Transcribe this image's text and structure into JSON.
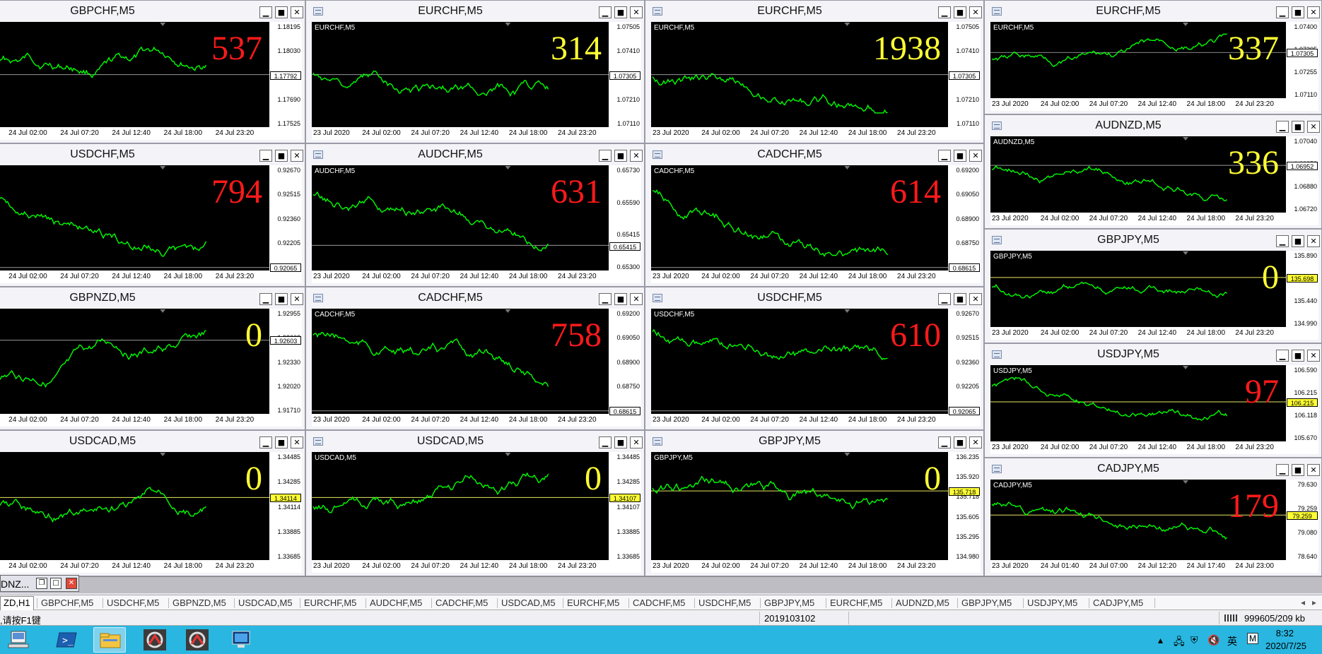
{
  "windows": [
    {
      "title": "GBPCHF,M5",
      "sym": "HF,M5",
      "icon": false,
      "bignum": "537",
      "color": "red",
      "ylabels": [
        "1.18195",
        "1.18030",
        "1.17860",
        "1.17690",
        "1.17525"
      ],
      "price": "1.17792",
      "pricePos": 0.5,
      "hl": false,
      "xlabels": [
        "20",
        "24 Jul 02:00",
        "24 Jul 07:20",
        "24 Jul 12:40",
        "24 Jul 18:00",
        "24 Jul 23:20"
      ]
    },
    {
      "title": "EURCHF,M5",
      "sym": "EURCHF,M5",
      "icon": true,
      "bignum": "314",
      "color": "yellow",
      "ylabels": [
        "1.07505",
        "1.07410",
        "1.07305",
        "1.07210",
        "1.07110"
      ],
      "price": "1.07305",
      "pricePos": 0.5,
      "hl": false,
      "xlabels": [
        "23 Jul 2020",
        "24 Jul 02:00",
        "24 Jul 07:20",
        "24 Jul 12:40",
        "24 Jul 18:00",
        "24 Jul 23:20"
      ]
    },
    {
      "title": "EURCHF,M5",
      "sym": "EURCHF,M5",
      "icon": true,
      "bignum": "1938",
      "color": "yellow",
      "ylabels": [
        "1.07505",
        "1.07410",
        "1.07305",
        "1.07210",
        "1.07110"
      ],
      "price": "1.07305",
      "pricePos": 0.5,
      "hl": false,
      "xlabels": [
        "23 Jul 2020",
        "24 Jul 02:00",
        "24 Jul 07:20",
        "24 Jul 12:40",
        "24 Jul 18:00",
        "24 Jul 23:20"
      ]
    },
    {
      "title": "EURCHF,M5",
      "sym": "EURCHF,M5",
      "icon": true,
      "bignum": "337",
      "color": "yellow",
      "ylabels": [
        "1.07400",
        "1.07305",
        "1.07255",
        "1.07110"
      ],
      "price": "1.07305",
      "pricePos": 0.4,
      "hl": false,
      "xlabels": [
        "23 Jul 2020",
        "24 Jul 02:00",
        "24 Jul 07:20",
        "24 Jul 12:40",
        "24 Jul 18:00",
        "24 Jul 23:20"
      ]
    },
    {
      "title": "USDCHF,M5",
      "sym": "HF,M5",
      "icon": false,
      "bignum": "794",
      "color": "red",
      "ylabels": [
        "0.92670",
        "0.92515",
        "0.92360",
        "0.92205",
        "0.92065"
      ],
      "price": "0.92065",
      "pricePos": 0.97,
      "hl": false,
      "xlabels": [
        "20",
        "24 Jul 02:00",
        "24 Jul 07:20",
        "24 Jul 12:40",
        "24 Jul 18:00",
        "24 Jul 23:20"
      ]
    },
    {
      "title": "AUDCHF,M5",
      "sym": "AUDCHF,M5",
      "icon": true,
      "bignum": "631",
      "color": "red",
      "ylabels": [
        "0.65730",
        "0.65590",
        "0.65415",
        "0.65300"
      ],
      "price": "0.65415",
      "pricePos": 0.76,
      "hl": false,
      "xlabels": [
        "23 Jul 2020",
        "24 Jul 02:00",
        "24 Jul 07:20",
        "24 Jul 12:40",
        "24 Jul 18:00",
        "24 Jul 23:20"
      ]
    },
    {
      "title": "CADCHF,M5",
      "sym": "CADCHF,M5",
      "icon": true,
      "bignum": "614",
      "color": "red",
      "ylabels": [
        "0.69200",
        "0.69050",
        "0.68900",
        "0.68750",
        "0.68615"
      ],
      "price": "0.68615",
      "pricePos": 0.97,
      "hl": false,
      "xlabels": [
        "23 Jul 2020",
        "24 Jul 02:00",
        "24 Jul 07:20",
        "24 Jul 12:40",
        "24 Jul 18:00",
        "24 Jul 23:20"
      ]
    },
    {
      "title": "AUDNZD,M5",
      "sym": "AUDNZD,M5",
      "icon": true,
      "bignum": "336",
      "color": "yellow",
      "ylabels": [
        "1.07040",
        "1.06952",
        "1.06880",
        "1.06720"
      ],
      "price": "1.06952",
      "pricePos": 0.38,
      "hl": false,
      "xlabels": [
        "23 Jul 2020",
        "24 Jul 02:00",
        "24 Jul 07:20",
        "24 Jul 12:40",
        "24 Jul 18:00",
        "24 Jul 23:20"
      ]
    },
    {
      "title": "GBPJPY,M5",
      "sym": "GBPJPY,M5",
      "icon": true,
      "bignum": "0",
      "color": "yellow",
      "ylabels": [
        "135.890",
        "135.698",
        "135.440",
        "134.990"
      ],
      "price": "135.698",
      "pricePos": 0.35,
      "hl": true,
      "xlabels": [
        "23 Jul 2020",
        "24 Jul 02:00",
        "24 Jul 07:20",
        "24 Jul 12:40",
        "24 Jul 18:00",
        "24 Jul 23:20"
      ]
    },
    {
      "title": "GBPNZD,M5",
      "sym": "D,M5",
      "icon": false,
      "bignum": "0",
      "color": "yellow",
      "ylabels": [
        "1.92955",
        "1.92603",
        "1.92330",
        "1.92020",
        "1.91710"
      ],
      "price": "1.92603",
      "pricePos": 0.3,
      "hl": false,
      "xlabels": [
        "20",
        "24 Jul 02:00",
        "24 Jul 07:20",
        "24 Jul 12:40",
        "24 Jul 18:00",
        "24 Jul 23:20"
      ]
    },
    {
      "title": "CADCHF,M5",
      "sym": "CADCHF,M5",
      "icon": true,
      "bignum": "758",
      "color": "red",
      "ylabels": [
        "0.69200",
        "0.69050",
        "0.68900",
        "0.68750",
        "0.68615"
      ],
      "price": "0.68615",
      "pricePos": 0.97,
      "hl": false,
      "xlabels": [
        "23 Jul 2020",
        "24 Jul 02:00",
        "24 Jul 07:20",
        "24 Jul 12:40",
        "24 Jul 18:00",
        "24 Jul 23:20"
      ]
    },
    {
      "title": "USDCHF,M5",
      "sym": "USDCHF,M5",
      "icon": true,
      "bignum": "610",
      "color": "red",
      "ylabels": [
        "0.92670",
        "0.92515",
        "0.92360",
        "0.92205",
        "0.92065"
      ],
      "price": "0.92065",
      "pricePos": 0.97,
      "hl": false,
      "xlabels": [
        "23 Jul 2020",
        "24 Jul 02:00",
        "24 Jul 07:20",
        "24 Jul 12:40",
        "24 Jul 18:00",
        "24 Jul 23:20"
      ]
    },
    {
      "title": "USDJPY,M5",
      "sym": "USDJPY,M5",
      "icon": true,
      "bignum": "97",
      "color": "red",
      "ylabels": [
        "106.590",
        "106.215",
        "106.118",
        "105.670"
      ],
      "price": "106.215",
      "pricePos": 0.48,
      "hl": true,
      "xlabels": [
        "23 Jul 2020",
        "24 Jul 02:00",
        "24 Jul 07:20",
        "24 Jul 12:40",
        "24 Jul 18:00",
        "24 Jul 23:20"
      ]
    },
    {
      "title": "USDCAD,M5",
      "sym": "AD,M5",
      "icon": false,
      "bignum": "0",
      "color": "yellow",
      "ylabels": [
        "1.34485",
        "1.34285",
        "1.34114",
        "1.33885",
        "1.33685"
      ],
      "price": "1.34114",
      "pricePos": 0.42,
      "hl": true,
      "xlabels": [
        "20",
        "24 Jul 02:00",
        "24 Jul 07:20",
        "24 Jul 12:40",
        "24 Jul 18:00",
        "24 Jul 23:20"
      ]
    },
    {
      "title": "USDCAD,M5",
      "sym": "USDCAD,M5",
      "icon": true,
      "bignum": "0",
      "color": "yellow",
      "ylabels": [
        "1.34485",
        "1.34285",
        "1.34107",
        "1.33885",
        "1.33685"
      ],
      "price": "1.34107",
      "pricePos": 0.42,
      "hl": true,
      "xlabels": [
        "23 Jul 2020",
        "24 Jul 02:00",
        "24 Jul 07:20",
        "24 Jul 12:40",
        "24 Jul 18:00",
        "24 Jul 23:20"
      ]
    },
    {
      "title": "GBPJPY,M5",
      "sym": "GBPJPY,M5",
      "icon": true,
      "bignum": "0",
      "color": "yellow",
      "ylabels": [
        "136.235",
        "135.920",
        "135.718",
        "135.605",
        "135.295",
        "134.980"
      ],
      "price": "135.718",
      "pricePos": 0.36,
      "hl": true,
      "xlabels": [
        "23 Jul 2020",
        "24 Jul 02:00",
        "24 Jul 07:20",
        "24 Jul 12:40",
        "24 Jul 18:00",
        "24 Jul 23:20"
      ]
    },
    {
      "title": "CADJPY,M5",
      "sym": "CADJPY,M5",
      "icon": true,
      "bignum": "179",
      "color": "red",
      "ylabels": [
        "79.630",
        "79.259",
        "79.080",
        "78.640"
      ],
      "price": "79.259",
      "pricePos": 0.44,
      "hl": true,
      "xlabels": [
        "23 Jul 2020",
        "24 Jul 01:40",
        "24 Jul 07:00",
        "24 Jul 12:20",
        "24 Jul 17:40",
        "24 Jul 23:00"
      ]
    }
  ],
  "mdi_minimized": {
    "title": "DNZ..."
  },
  "tabs": [
    "ZD,H1",
    "GBPCHF,M5",
    "USDCHF,M5",
    "GBPNZD,M5",
    "USDCAD,M5",
    "EURCHF,M5",
    "AUDCHF,M5",
    "CADCHF,M5",
    "USDCAD,M5",
    "EURCHF,M5",
    "CADCHF,M5",
    "USDCHF,M5",
    "GBPJPY,M5",
    "EURCHF,M5",
    "AUDNZD,M5",
    "GBPJPY,M5",
    "USDJPY,M5",
    "CADJPY,M5"
  ],
  "status": {
    "help": ",请按F1键",
    "profile": "2019103102",
    "traffic": "999605/209 kb"
  },
  "tray": {
    "lang": "英",
    "ime": "M",
    "time": "8:32",
    "date": "2020/7/25"
  }
}
